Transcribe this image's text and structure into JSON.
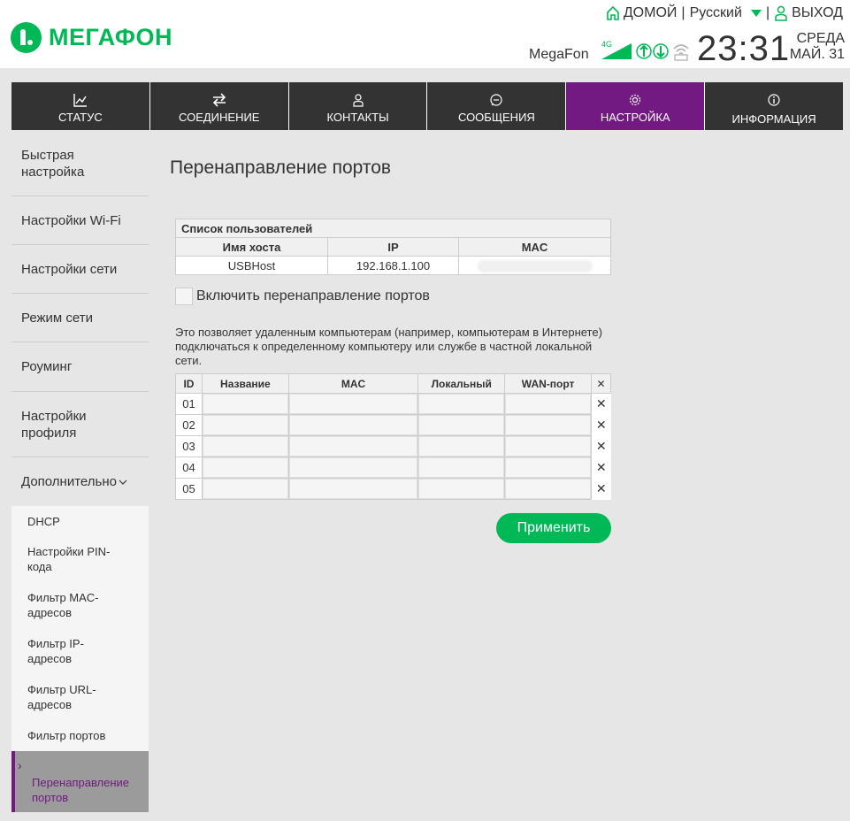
{
  "header": {
    "brand": "МЕГАФОН",
    "home_label": "ДОМОЙ",
    "language": "Русский",
    "logout_label": "ВЫХОД",
    "operator": "MegaFon",
    "network": "4G",
    "time": "23:31",
    "weekday": "СРЕДА",
    "date": "МАЙ. 31",
    "accent": "#00b956"
  },
  "nav": {
    "items": [
      {
        "label": "СТАТУС",
        "icon": "chart-icon"
      },
      {
        "label": "СОЕДИНЕНИЕ",
        "icon": "transfer-icon"
      },
      {
        "label": "КОНТАКТЫ",
        "icon": "person-icon"
      },
      {
        "label": "СООБЩЕНИЯ",
        "icon": "message-icon"
      },
      {
        "label": "НАСТРОЙКА",
        "icon": "gear-icon",
        "active": true
      },
      {
        "label": "ИНФОРМАЦИЯ",
        "icon": "info-icon"
      }
    ],
    "active_color": "#731982"
  },
  "sidebar": {
    "items": [
      {
        "label": "Быстрая настройка"
      },
      {
        "label": "Настройки Wi-Fi"
      },
      {
        "label": "Настройки сети"
      },
      {
        "label": "Режим сети"
      },
      {
        "label": "Роуминг"
      },
      {
        "label": "Настройки профиля"
      },
      {
        "label": "Дополнительно"
      }
    ],
    "sub_items": [
      {
        "label": "DHCP"
      },
      {
        "label": "Настройки PIN-кода"
      },
      {
        "label": "Фильтр MAC-адресов"
      },
      {
        "label": "Фильтр IP-адресов"
      },
      {
        "label": "Фильтр URL-адресов"
      },
      {
        "label": "Фильтр портов"
      },
      {
        "label": "Перенаправление портов",
        "active": true
      }
    ]
  },
  "main": {
    "title": "Перенаправление портов",
    "hosts": {
      "caption": "Список пользователей",
      "columns": [
        "Имя хоста",
        "IP",
        "MAC"
      ],
      "rows": [
        [
          "USBHost",
          "192.168.1.100",
          ""
        ]
      ]
    },
    "enable_label": "Включить перенаправление портов",
    "description": "Это позволяет удаленным компьютерам (например, компьютерам в Интернете) подключаться к определенному компьютеру или службе в частной локальной сети.",
    "rules": {
      "columns": [
        "ID",
        "Название",
        "MAC",
        "Локальный",
        "WAN-порт",
        "✕"
      ],
      "ids": [
        "01",
        "02",
        "03",
        "04",
        "05"
      ],
      "delete_glyph": "✕"
    },
    "apply_label": "Применить"
  }
}
